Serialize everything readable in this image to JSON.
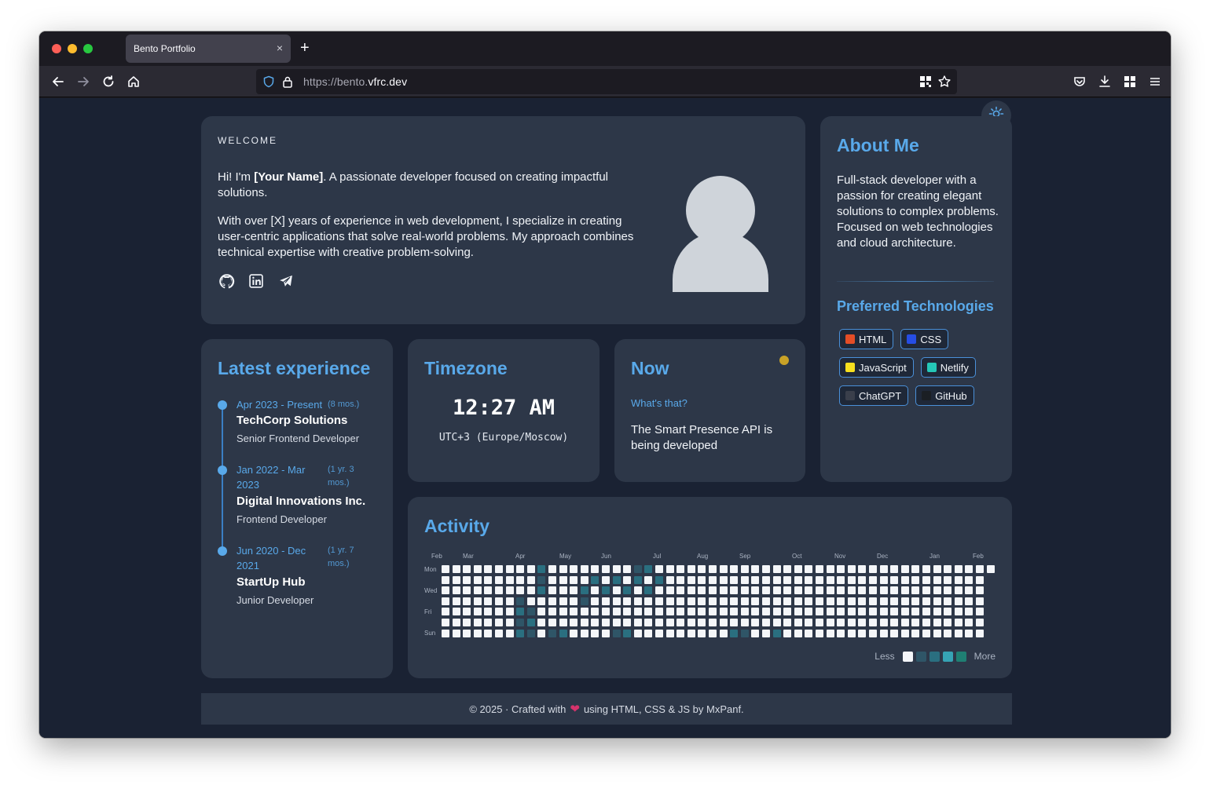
{
  "browser": {
    "tab_title": "Bento Portfolio",
    "tab_close": "×",
    "new_tab": "+",
    "url_prefix": "https://bento.",
    "url_domain": "vfrc.dev"
  },
  "welcome": {
    "label": "WELCOME",
    "intro_before": "Hi! I'm ",
    "intro_name": "[Your Name]",
    "intro_after": ". A passionate developer focused on creating impactful solutions.",
    "paragraph": "With over [X] years of experience in web development, I specialize in creating user-centric applications that solve real-world problems. My approach combines technical expertise with creative problem-solving.",
    "socials": [
      "github-icon",
      "linkedin-icon",
      "telegram-icon"
    ]
  },
  "about": {
    "title": "About Me",
    "text": "Full-stack developer with a passion for creating elegant solutions to complex problems. Focused on web technologies and cloud architecture.",
    "tech_title": "Preferred Technologies",
    "techs": [
      {
        "label": "HTML",
        "color": "#e44d26"
      },
      {
        "label": "CSS",
        "color": "#264de4"
      },
      {
        "label": "JavaScript",
        "color": "#f7df1e"
      },
      {
        "label": "Netlify",
        "color": "#25c7b7"
      },
      {
        "label": "ChatGPT",
        "color": "#3a3f4b"
      },
      {
        "label": "GitHub",
        "color": "#1b1f24"
      }
    ]
  },
  "experience": {
    "title": "Latest experience",
    "items": [
      {
        "date": "Apr 2023 - Present",
        "duration": "(8 mos.)",
        "company": "TechCorp Solutions",
        "role": "Senior Frontend Developer"
      },
      {
        "date": "Jan 2022 - Mar 2023",
        "duration": "(1 yr. 3 mos.)",
        "company": "Digital Innovations Inc.",
        "role": "Frontend Developer"
      },
      {
        "date": "Jun 2020 - Dec 2021",
        "duration": "(1 yr. 7 mos.)",
        "company": "StartUp Hub",
        "role": "Junior Developer"
      }
    ]
  },
  "timezone": {
    "title": "Timezone",
    "time": "12:27 AM",
    "zone": "UTC+3 (Europe/Moscow)"
  },
  "now": {
    "title": "Now",
    "question": "What's that?",
    "text": "The Smart Presence API is being developed",
    "status_color": "#c9a227"
  },
  "activity": {
    "title": "Activity",
    "months": [
      "Feb",
      "Mar",
      "Apr",
      "May",
      "Jun",
      "Jul",
      "Aug",
      "Sep",
      "Oct",
      "Nov",
      "Dec",
      "Jan",
      "Feb"
    ],
    "days": [
      "Mon",
      "Wed",
      "Fri",
      "Sun"
    ],
    "legend_less": "Less",
    "legend_more": "More",
    "level_colors": [
      "#f4f6f9",
      "#2f5567",
      "#2a6f80",
      "#36a3b4",
      "#1f7f73"
    ],
    "weeks": 52,
    "active_cells": [
      [
        7,
        3
      ],
      [
        7,
        4
      ],
      [
        7,
        5
      ],
      [
        7,
        6
      ],
      [
        8,
        4
      ],
      [
        8,
        5
      ],
      [
        8,
        6
      ],
      [
        9,
        0
      ],
      [
        9,
        1
      ],
      [
        9,
        2
      ],
      [
        13,
        2
      ],
      [
        13,
        3
      ],
      [
        14,
        1
      ],
      [
        15,
        2
      ],
      [
        16,
        1
      ],
      [
        17,
        2
      ],
      [
        18,
        0
      ],
      [
        18,
        1
      ],
      [
        19,
        0
      ],
      [
        19,
        2
      ],
      [
        20,
        1
      ],
      [
        31,
        6
      ],
      [
        27,
        6
      ],
      [
        28,
        6
      ],
      [
        17,
        6
      ],
      [
        16,
        6
      ],
      [
        10,
        6
      ],
      [
        11,
        6
      ]
    ]
  },
  "footer": {
    "before": "© 2025 · Crafted with",
    "after": "using HTML, CSS & JS by MxPanf."
  }
}
